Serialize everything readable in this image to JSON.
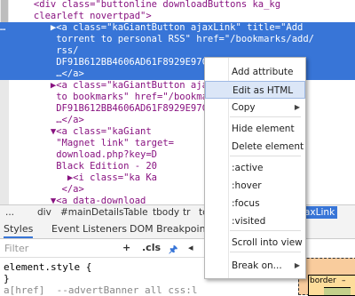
{
  "dom": {
    "lines": [
      {
        "text": "      <div class=\"buttonline downloadButtons ka_kg",
        "sel": false
      },
      {
        "text": "      clearleft novertpad\">",
        "sel": false
      },
      {
        "text": "…        ▶<a class=\"kaGiantButton ajaxLink\" title=\"Add",
        "sel": true
      },
      {
        "text": "          torrent to personal RSS\" href=\"/bookmarks/add/",
        "sel": true
      },
      {
        "text": "          rss/",
        "sel": true
      },
      {
        "text": "          DF91B612BB4606AD61F8929E97C75D195A43FAA3/\">",
        "sel": true
      },
      {
        "text": "          …</a>",
        "sel": true
      },
      {
        "text": "         ▶<a class=\"kaGiantButton ajaxLink\" title=\"Add",
        "sel": false
      },
      {
        "text": "          to bookmarks\" href=\"/bookmarks/add/",
        "sel": false
      },
      {
        "text": "          DF91B612BB4606AD61F8929E97C75D195A43FAA3/",
        "sel": false
      },
      {
        "text": "          …</a>",
        "sel": false
      },
      {
        "text": "         ▼<a class=\"kaGiant                 title=",
        "sel": false
      },
      {
        "text": "          \"Magnet link\" target=                 SP3",
        "sel": false
      },
      {
        "text": "          download.php?key=D",
        "sel": false
      },
      {
        "text": "          Black Edition - 20               orrent\">",
        "sel": false
      },
      {
        "text": "            ▶<i class=\"ka Ka",
        "sel": false
      },
      {
        "text": "           </a>",
        "sel": false
      },
      {
        "text": "         ▼<a data-download                  title=",
        "sel": false
      },
      {
        "text": "          \"kaGiantButton sit                 ss=",
        "sel": false
      }
    ]
  },
  "breadcrumbs": [
    "...",
    "div",
    "#mainDetailsTable",
    "tbody",
    "tr",
    "td",
    "axLink"
  ],
  "tabs": [
    "Styles",
    "Event Listeners",
    "DOM Breakpoints",
    "Pr"
  ],
  "filter": {
    "placeholder": "Filter",
    "tools": [
      "+",
      ".cls",
      "🖈",
      "◂"
    ]
  },
  "styles_lines": [
    "element.style {",
    "}",
    "a[href]  --advertBanner all css:l"
  ],
  "boxmodel": {
    "border_label": "border",
    "border_value": "–"
  },
  "context_menu": {
    "items": [
      {
        "label": "Add attribute",
        "highlight": false,
        "submenu": false
      },
      {
        "label": "Edit as HTML",
        "highlight": true,
        "submenu": false
      },
      {
        "label": "Copy",
        "highlight": false,
        "submenu": true
      },
      {
        "label": "Hide element",
        "highlight": false,
        "submenu": false
      },
      {
        "label": "Delete element",
        "highlight": false,
        "submenu": false
      },
      {
        "label": ":active",
        "highlight": false,
        "submenu": false
      },
      {
        "label": ":hover",
        "highlight": false,
        "submenu": false
      },
      {
        "label": ":focus",
        "highlight": false,
        "submenu": false
      },
      {
        "label": ":visited",
        "highlight": false,
        "submenu": false
      },
      {
        "label": "Scroll into view",
        "highlight": false,
        "submenu": false
      },
      {
        "label": "Break on...",
        "highlight": false,
        "submenu": true
      }
    ]
  },
  "colors": {
    "selection": "#3875d7",
    "menu_highlight": "#dbe6f7"
  }
}
